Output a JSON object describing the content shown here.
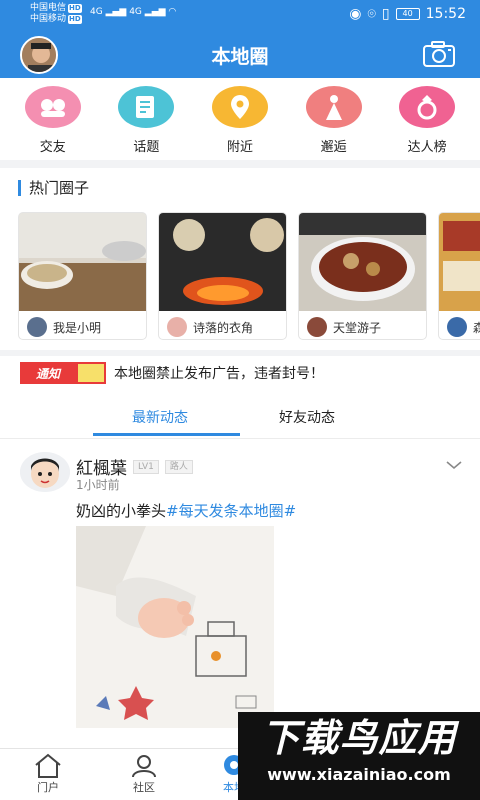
{
  "statusbar": {
    "carrier1": "中国电信",
    "carrier2": "中国移动",
    "hd": "HD",
    "net": "4G",
    "battery": "40",
    "time": "15:52"
  },
  "header": {
    "title": "本地圈"
  },
  "quick_actions": [
    {
      "label": "交友",
      "icon": "friends-icon",
      "color": "#f48fb1"
    },
    {
      "label": "话题",
      "icon": "topic-icon",
      "color": "#4dc3d6"
    },
    {
      "label": "附近",
      "icon": "location-icon",
      "color": "#f7b733"
    },
    {
      "label": "邂逅",
      "icon": "wedding-icon",
      "color": "#f07f7f"
    },
    {
      "label": "达人榜",
      "icon": "ring-icon",
      "color": "#f06292"
    }
  ],
  "hot_circles": {
    "title": "热门圈子",
    "items": [
      {
        "name": "我是小明"
      },
      {
        "name": "诗落的衣角"
      },
      {
        "name": "天堂游子"
      },
      {
        "name": "森"
      }
    ]
  },
  "notice": {
    "badge": "通知",
    "text": "本地圈禁止发布广告，违者封号！"
  },
  "tabs": [
    {
      "label": "最新动态",
      "active": true
    },
    {
      "label": "好友动态",
      "active": false
    }
  ],
  "post": {
    "author": "紅楓葉",
    "level": "LV1",
    "tag": "路人",
    "time": "1小时前",
    "text": "奶凶的小拳头",
    "topic": "#每天发条本地圈#"
  },
  "bottom_nav": [
    {
      "label": "门户",
      "active": false
    },
    {
      "label": "社区",
      "active": false
    },
    {
      "label": "本地",
      "active": true
    }
  ],
  "watermark": {
    "title": "下载鸟应用",
    "url": "www.xiazainiao.com"
  }
}
